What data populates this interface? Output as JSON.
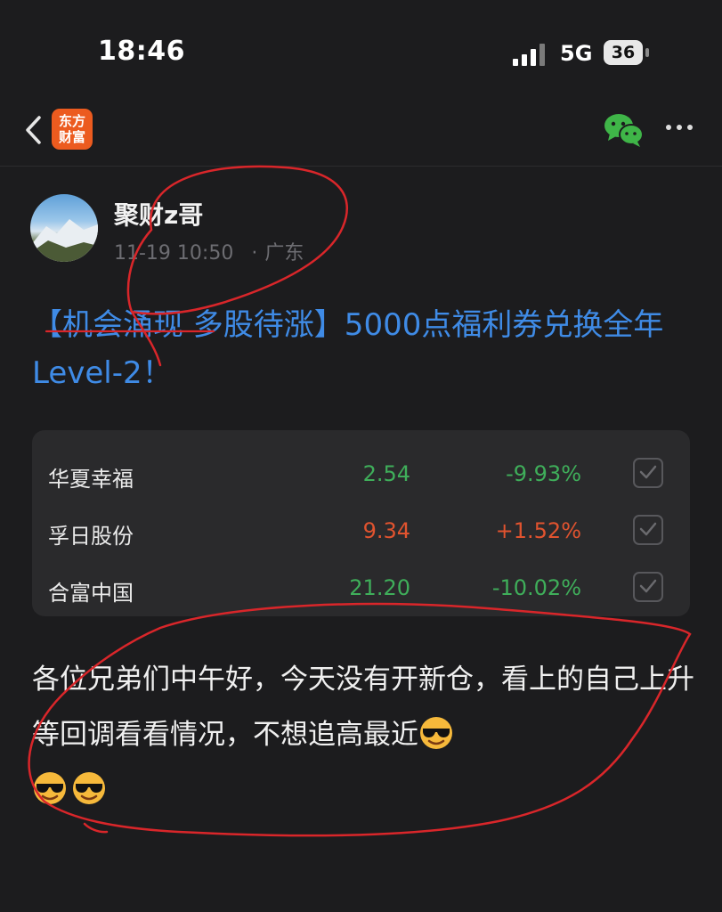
{
  "status_bar": {
    "time": "18:46",
    "network": "5G",
    "battery": "36"
  },
  "nav": {
    "logo_line1": "东方",
    "logo_line2": "财富"
  },
  "post": {
    "author": "聚财z哥",
    "date": "11-19 10:50",
    "location": "广东",
    "title": "【机会涌现 多股待涨】5000点福利券兑换全年Level-2！",
    "body": "各位兄弟们中午好，今天没有开新仓，看上的自己上升等回调看看情况，不想追高最近"
  },
  "stocks": [
    {
      "name": "华夏幸福",
      "price": "2.54",
      "change": "-9.93%",
      "trend": "down"
    },
    {
      "name": "孚日股份",
      "price": "9.34",
      "change": "+1.52%",
      "trend": "up"
    },
    {
      "name": "合富中国",
      "price": "21.20",
      "change": "-10.02%",
      "trend": "down"
    }
  ],
  "colors": {
    "up": "#e0532f",
    "down": "#3fae5a",
    "link": "#3f8be6",
    "brand": "#ec5b1f",
    "annotation": "#d9262a"
  },
  "icons": [
    "back-icon",
    "wechat-icon",
    "more-icon",
    "checkbox-icon",
    "sunglasses-emoji-icon"
  ]
}
